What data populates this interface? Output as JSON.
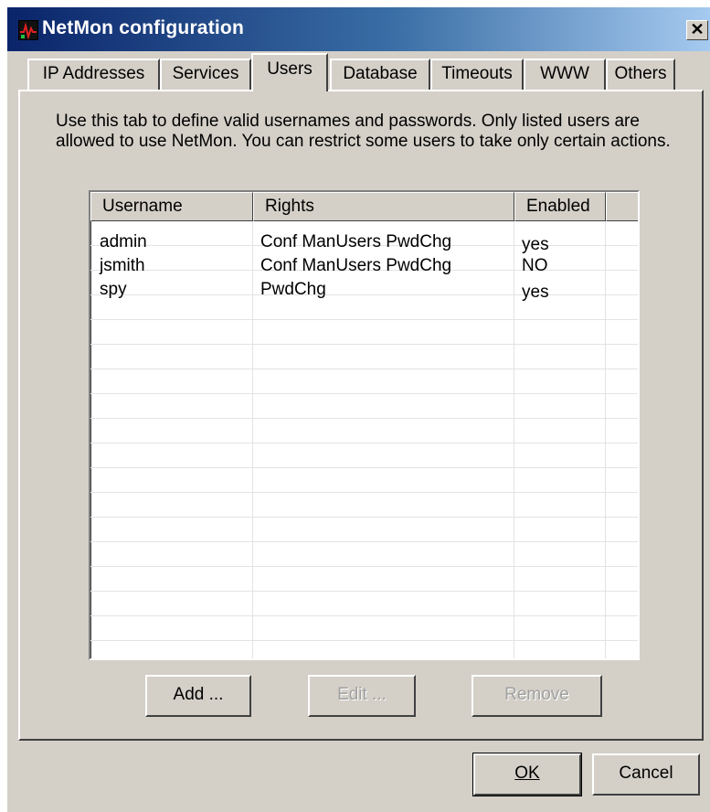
{
  "window": {
    "title": "NetMon configuration",
    "close_label": "✕"
  },
  "tabs": [
    {
      "label": "IP Addresses",
      "active": false
    },
    {
      "label": "Services",
      "active": false
    },
    {
      "label": "Users",
      "active": true
    },
    {
      "label": "Database",
      "active": false
    },
    {
      "label": "Timeouts",
      "active": false
    },
    {
      "label": "WWW",
      "active": false
    },
    {
      "label": "Others",
      "active": false
    }
  ],
  "users_tab": {
    "description": "Use this tab to define valid usernames and passwords. Only listed users are allowed to use NetMon. You can restrict some users to take only certain actions.",
    "columns": [
      "Username",
      "Rights",
      "Enabled"
    ],
    "rows": [
      {
        "username": "admin",
        "rights": "Conf ManUsers PwdChg",
        "enabled": "yes"
      },
      {
        "username": "jsmith",
        "rights": "Conf ManUsers PwdChg",
        "enabled": "NO"
      },
      {
        "username": "spy",
        "rights": "PwdChg",
        "enabled": "yes"
      }
    ],
    "buttons": {
      "add": "Add ...",
      "edit": "Edit ...",
      "remove": "Remove"
    }
  },
  "dialog_buttons": {
    "ok": "OK",
    "cancel": "Cancel"
  }
}
